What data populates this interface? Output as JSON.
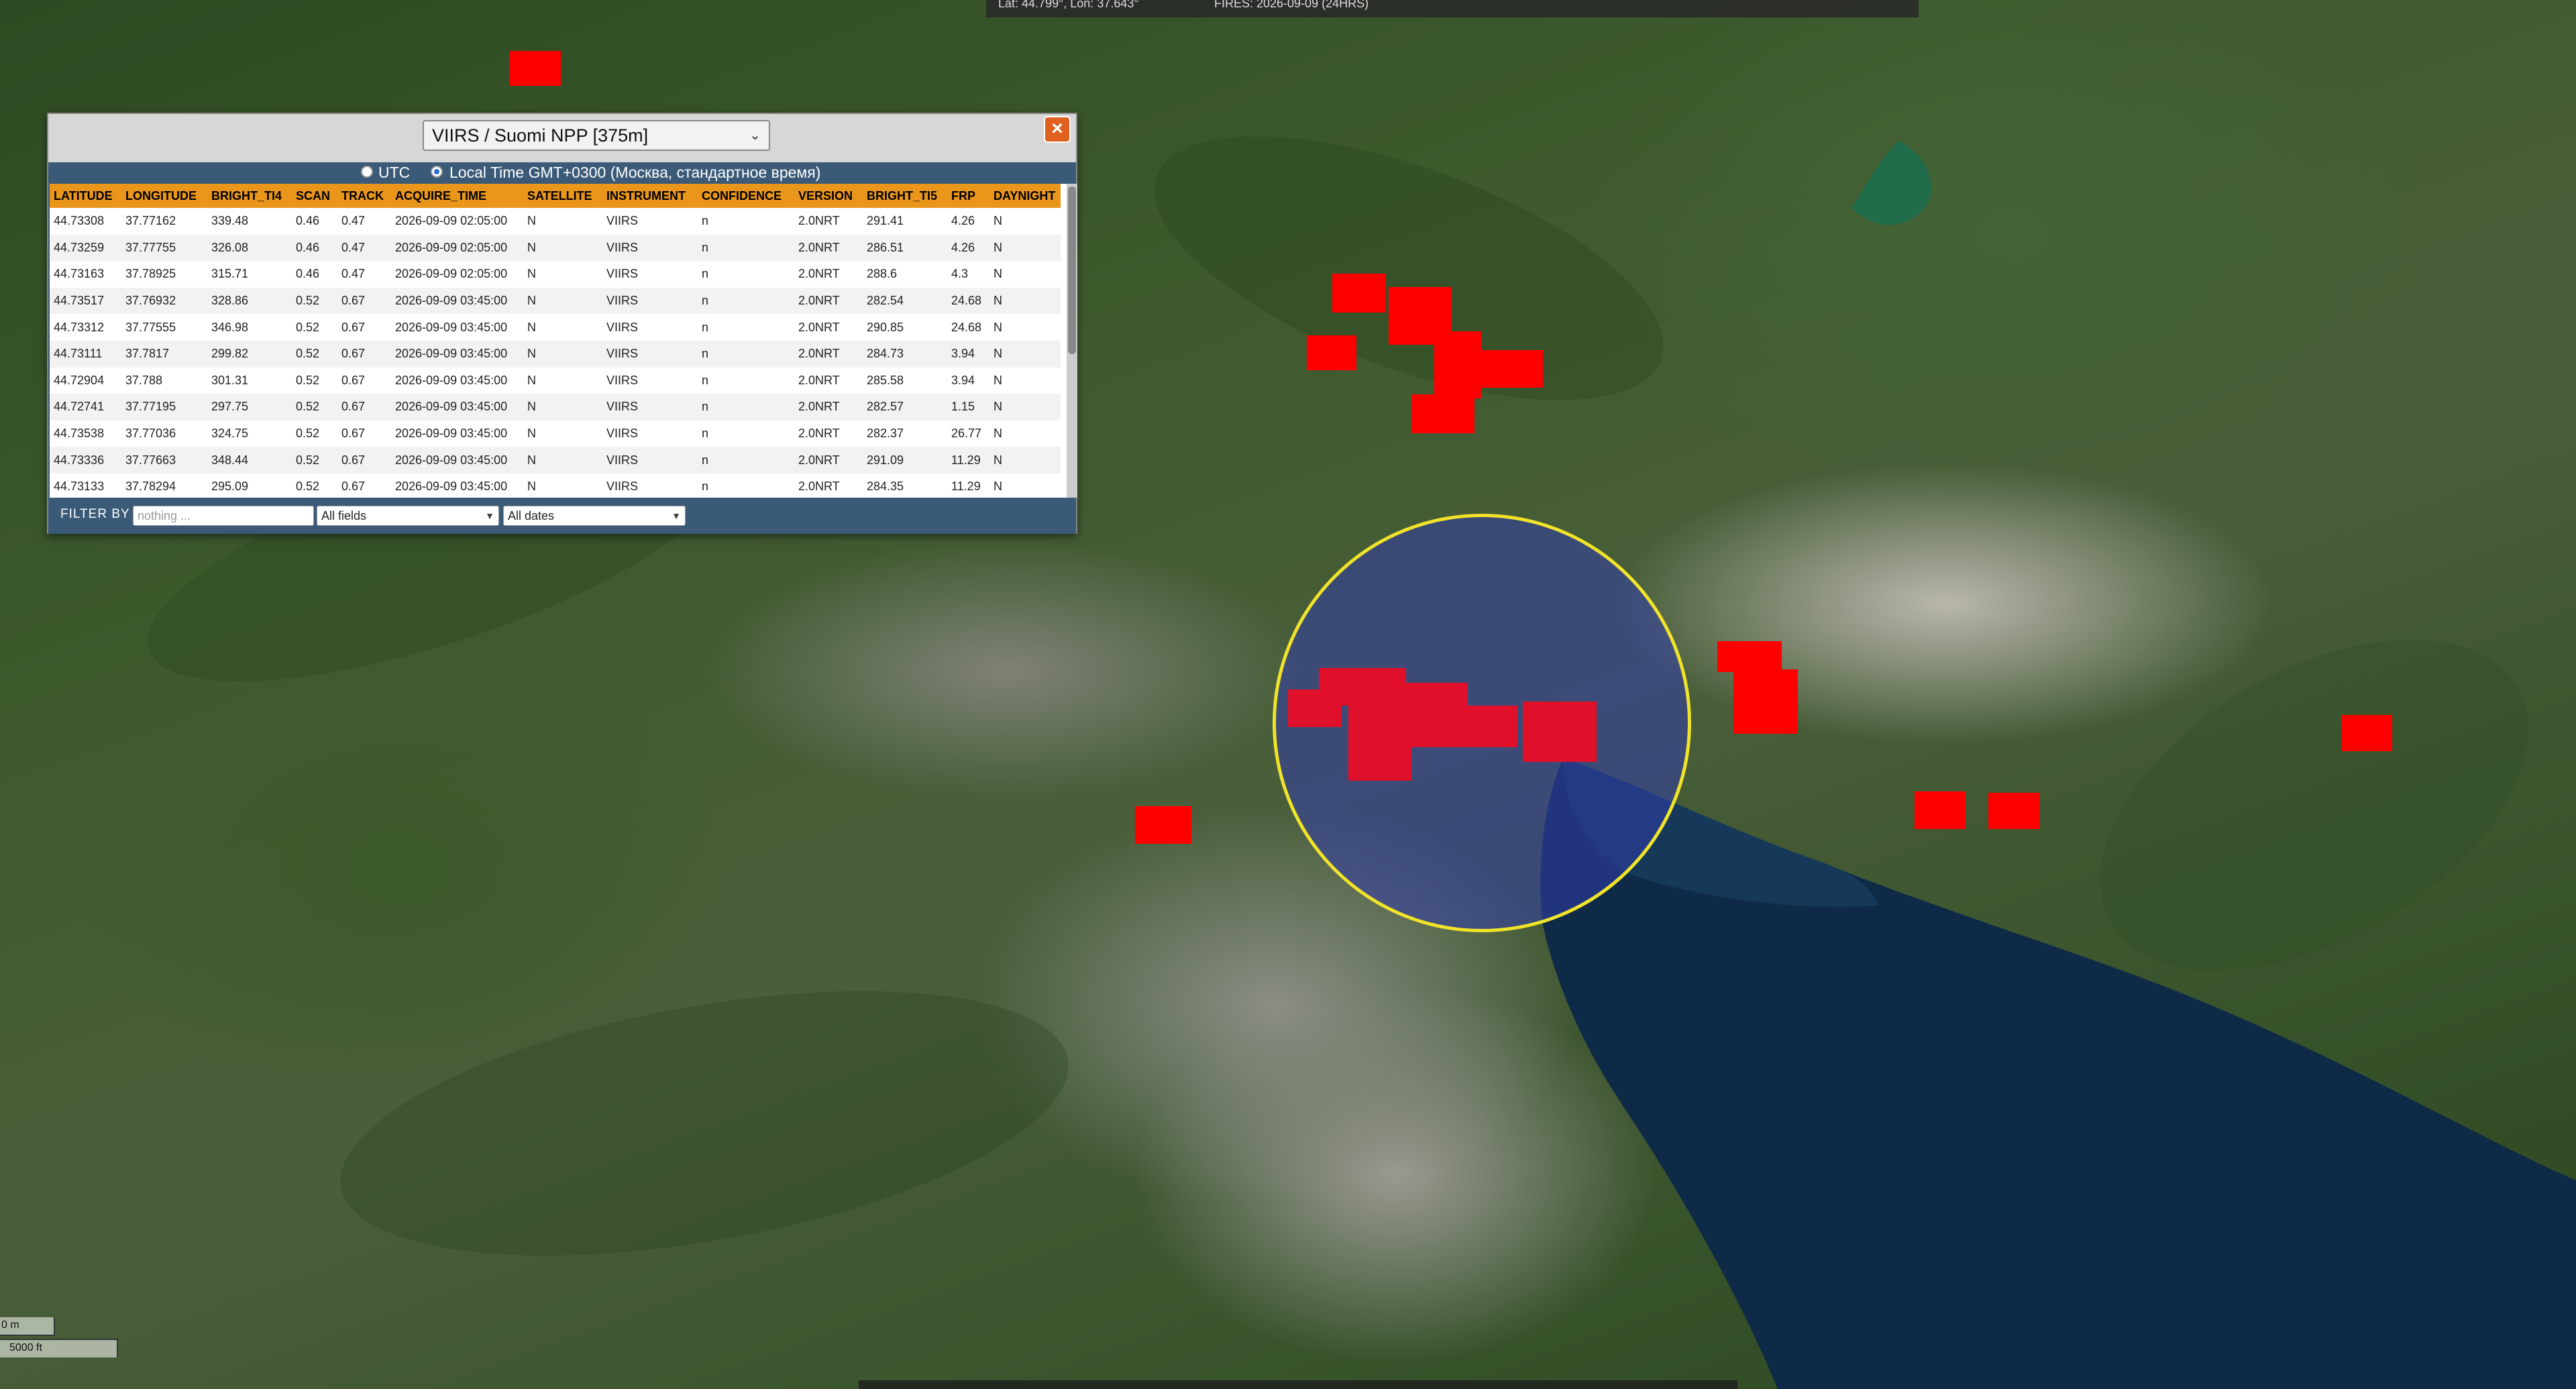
{
  "status_bar": {
    "coords": "Lat: 44.799°, Lon: 37.643°",
    "fires": "FIRES: 2026-09-09 (24HRS)"
  },
  "colors": {
    "fire": "#ff0000",
    "selection_border": "#f0e32a",
    "selection_fill": "#3240aa",
    "header_bg": "#e9961a",
    "panel_bg": "#3b5a78"
  },
  "panel": {
    "sensor": "VIIRS / Suomi NPP [375m]",
    "close_icon": "close-icon",
    "time_options": {
      "utc": "UTC",
      "local": "Local Time GMT+0300 (Москва, стандартное время)",
      "selected": "local"
    },
    "columns": [
      "LATITUDE",
      "LONGITUDE",
      "BRIGHT_TI4",
      "SCAN",
      "TRACK",
      "ACQUIRE_TIME",
      "SATELLITE",
      "INSTRUMENT",
      "CONFIDENCE",
      "VERSION",
      "BRIGHT_TI5",
      "FRP",
      "DAYNIGHT"
    ],
    "rows": [
      [
        "44.73308",
        "37.77162",
        "339.48",
        "0.46",
        "0.47",
        "2026-09-09 02:05:00",
        "N",
        "VIIRS",
        "n",
        "2.0NRT",
        "291.41",
        "4.26",
        "N"
      ],
      [
        "44.73259",
        "37.77755",
        "326.08",
        "0.46",
        "0.47",
        "2026-09-09 02:05:00",
        "N",
        "VIIRS",
        "n",
        "2.0NRT",
        "286.51",
        "4.26",
        "N"
      ],
      [
        "44.73163",
        "37.78925",
        "315.71",
        "0.46",
        "0.47",
        "2026-09-09 02:05:00",
        "N",
        "VIIRS",
        "n",
        "2.0NRT",
        "288.6",
        "4.3",
        "N"
      ],
      [
        "44.73517",
        "37.76932",
        "328.86",
        "0.52",
        "0.67",
        "2026-09-09 03:45:00",
        "N",
        "VIIRS",
        "n",
        "2.0NRT",
        "282.54",
        "24.68",
        "N"
      ],
      [
        "44.73312",
        "37.77555",
        "346.98",
        "0.52",
        "0.67",
        "2026-09-09 03:45:00",
        "N",
        "VIIRS",
        "n",
        "2.0NRT",
        "290.85",
        "24.68",
        "N"
      ],
      [
        "44.73111",
        "37.7817",
        "299.82",
        "0.52",
        "0.67",
        "2026-09-09 03:45:00",
        "N",
        "VIIRS",
        "n",
        "2.0NRT",
        "284.73",
        "3.94",
        "N"
      ],
      [
        "44.72904",
        "37.788",
        "301.31",
        "0.52",
        "0.67",
        "2026-09-09 03:45:00",
        "N",
        "VIIRS",
        "n",
        "2.0NRT",
        "285.58",
        "3.94",
        "N"
      ],
      [
        "44.72741",
        "37.77195",
        "297.75",
        "0.52",
        "0.67",
        "2026-09-09 03:45:00",
        "N",
        "VIIRS",
        "n",
        "2.0NRT",
        "282.57",
        "1.15",
        "N"
      ],
      [
        "44.73538",
        "37.77036",
        "324.75",
        "0.52",
        "0.67",
        "2026-09-09 03:45:00",
        "N",
        "VIIRS",
        "n",
        "2.0NRT",
        "282.37",
        "26.77",
        "N"
      ],
      [
        "44.73336",
        "37.77663",
        "348.44",
        "0.52",
        "0.67",
        "2026-09-09 03:45:00",
        "N",
        "VIIRS",
        "n",
        "2.0NRT",
        "291.09",
        "11.29",
        "N"
      ],
      [
        "44.73133",
        "37.78294",
        "295.09",
        "0.52",
        "0.67",
        "2026-09-09 03:45:00",
        "N",
        "VIIRS",
        "n",
        "2.0NRT",
        "284.35",
        "11.29",
        "N"
      ]
    ],
    "filter": {
      "label": "FILTER BY",
      "placeholder": "nothing ...",
      "field": "All fields",
      "dates": "All dates"
    }
  },
  "scale": {
    "metric": "0 m",
    "imperial": "5000 ft"
  }
}
